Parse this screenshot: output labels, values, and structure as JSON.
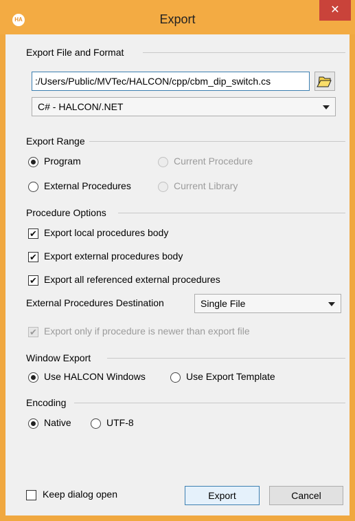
{
  "window": {
    "title": "Export",
    "app_icon_text": "HA",
    "close_glyph": "✕"
  },
  "export_file": {
    "group_title": "Export File and Format",
    "path_value": ":/Users/Public/MVTec/HALCON/cpp/cbm_dip_switch.cs",
    "format_selected": "C# - HALCON/.NET"
  },
  "export_range": {
    "group_title": "Export Range",
    "program": "Program",
    "current_procedure": "Current Procedure",
    "external_procedures": "External Procedures",
    "current_library": "Current Library",
    "selected": "Program"
  },
  "procedure_options": {
    "group_title": "Procedure Options",
    "local_body": "Export local procedures body",
    "external_body": "Export external procedures body",
    "all_referenced": "Export all referenced external procedures",
    "destination_label": "External Procedures Destination",
    "destination_selected": "Single File",
    "only_if_newer": "Export only if procedure is newer than export file"
  },
  "window_export": {
    "group_title": "Window Export",
    "use_halcon": "Use HALCON Windows",
    "use_template": "Use Export Template",
    "selected": "Use HALCON Windows"
  },
  "encoding": {
    "group_title": "Encoding",
    "native": "Native",
    "utf8": "UTF-8",
    "selected": "Native"
  },
  "footer": {
    "keep_open": "Keep dialog open",
    "export_btn": "Export",
    "cancel_btn": "Cancel"
  },
  "icons": {
    "folder": "folder-open-icon",
    "check_glyph": "✔"
  },
  "colors": {
    "titlebar": "#f3ab43",
    "close": "#c9433a",
    "focus_border": "#3c7fb1"
  }
}
